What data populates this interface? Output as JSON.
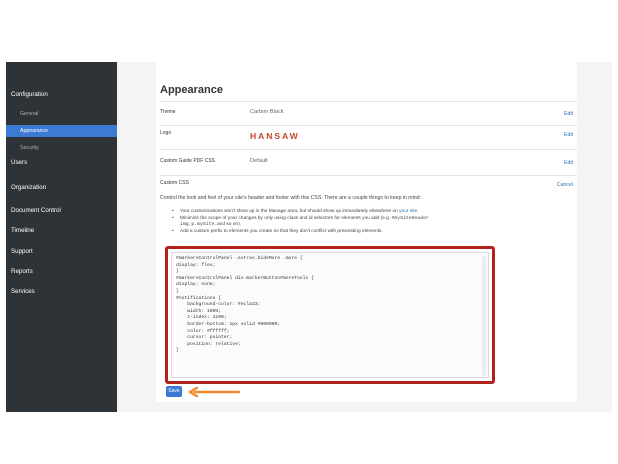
{
  "sidebar": {
    "items": [
      {
        "label": "Configuration",
        "type": "section"
      },
      {
        "label": "General",
        "type": "sub"
      },
      {
        "label": "Appearance",
        "type": "sub",
        "active": true
      },
      {
        "label": "Security",
        "type": "sub"
      },
      {
        "label": "Users",
        "type": "section"
      },
      {
        "label": "Organization",
        "type": "section"
      },
      {
        "label": "Document Control",
        "type": "section"
      },
      {
        "label": "Timeline",
        "type": "section"
      },
      {
        "label": "Support",
        "type": "section"
      },
      {
        "label": "Reports",
        "type": "section"
      },
      {
        "label": "Services",
        "type": "section"
      }
    ]
  },
  "page": {
    "title": "Appearance"
  },
  "settings": {
    "theme": {
      "label": "Theme",
      "value": "Carbon Black",
      "action": "Edit"
    },
    "logo": {
      "label": "Logo",
      "value": "HANSAW",
      "action": "Edit"
    },
    "pdf_css": {
      "label": "Custom Guide PDF CSS",
      "value": "Default",
      "action": "Edit"
    },
    "custom_css": {
      "label": "Custom CSS",
      "action": "Cancel"
    }
  },
  "custom_css_help": {
    "intro": "Control the look and feel of your site's header and footer with this CSS. There are a couple things to keep in mind:",
    "b1_text": "Your customizations won't show up in the Manage area, but should show up immediately elsewhere on ",
    "b1_link": "your site",
    "b1_end": ".",
    "b2_text": "Minimize the scope of your changes by only using class and id selectors for elements you add (e.g. ",
    "b2_code1": "#mySiteHeader",
    "b2_line2_a": "",
    "b2_code2": "img",
    "b2_sep": ", ",
    "b2_code3": "p.mySite",
    "b2_end": ", and so on).",
    "b3_text": "Add a custom prefix to elements you create so that they don't conflict with preexisting elements."
  },
  "editor": {
    "lines": [
      "#markersControlPanel .extras.hideMore .more {",
      "display: flex;",
      "}",
      "",
      "#markersControlPanel div.markerButton#moreTools {",
      "display: none;",
      "}",
      "",
      "#notifications {",
      "    background-color: #ecla23;",
      "    width: 100%;",
      "    z-index: 1100;",
      "    border-bottom: 1px solid #000000;",
      "    color: #ffffff;",
      "    cursor: pointer;",
      "    position: relative;",
      "}"
    ]
  },
  "save_label": "Save",
  "colors": {
    "sidebar": "#2e3338",
    "accent": "#3b7bd4",
    "highlight_border": "#b2241b",
    "arrow": "#f08a2a",
    "logo": "#c3452c"
  }
}
